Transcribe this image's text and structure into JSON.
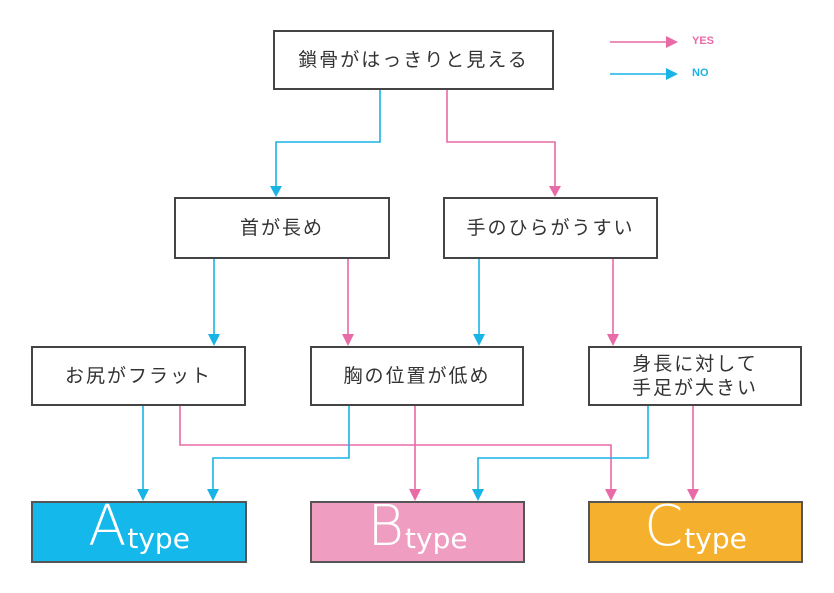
{
  "colors": {
    "yes": "#e86aa6",
    "no": "#19b4e6",
    "type_a": "#14b8ea",
    "type_b": "#ef9ec2",
    "type_c": "#f5b02e"
  },
  "legend": {
    "yes_label": "YES",
    "no_label": "NO"
  },
  "nodes": {
    "q1": "鎖骨がはっきりと見える",
    "q2_no": "首が長め",
    "q2_yes": "手のひらがうすい",
    "q3_a": "お尻がフラット",
    "q3_b": "胸の位置が低め",
    "q3_c": "身長に対して\n手足が大きい"
  },
  "results": [
    {
      "letter": "A",
      "suffix": "type"
    },
    {
      "letter": "B",
      "suffix": "type"
    },
    {
      "letter": "C",
      "suffix": "type"
    }
  ],
  "edges": [
    {
      "from": "鎖骨がはっきりと見える",
      "to": "首が長め",
      "answer": "NO"
    },
    {
      "from": "鎖骨がはっきりと見える",
      "to": "手のひらがうすい",
      "answer": "YES"
    },
    {
      "from": "首が長め",
      "to": "お尻がフラット",
      "answer": "NO"
    },
    {
      "from": "首が長め",
      "to": "胸の位置が低め",
      "answer": "YES"
    },
    {
      "from": "手のひらがうすい",
      "to": "胸の位置が低め",
      "answer": "NO"
    },
    {
      "from": "手のひらがうすい",
      "to": "身長に対して手足が大きい",
      "answer": "YES"
    },
    {
      "from": "お尻がフラット",
      "to": "Atype",
      "answer": "NO"
    },
    {
      "from": "お尻がフラット",
      "to": "Ctype",
      "answer": "YES"
    },
    {
      "from": "胸の位置が低め",
      "to": "Atype",
      "answer": "NO"
    },
    {
      "from": "胸の位置が低め",
      "to": "Btype",
      "answer": "YES"
    },
    {
      "from": "身長に対して手足が大きい",
      "to": "Btype",
      "answer": "NO"
    },
    {
      "from": "身長に対して手足が大きい",
      "to": "Ctype",
      "answer": "YES"
    }
  ]
}
